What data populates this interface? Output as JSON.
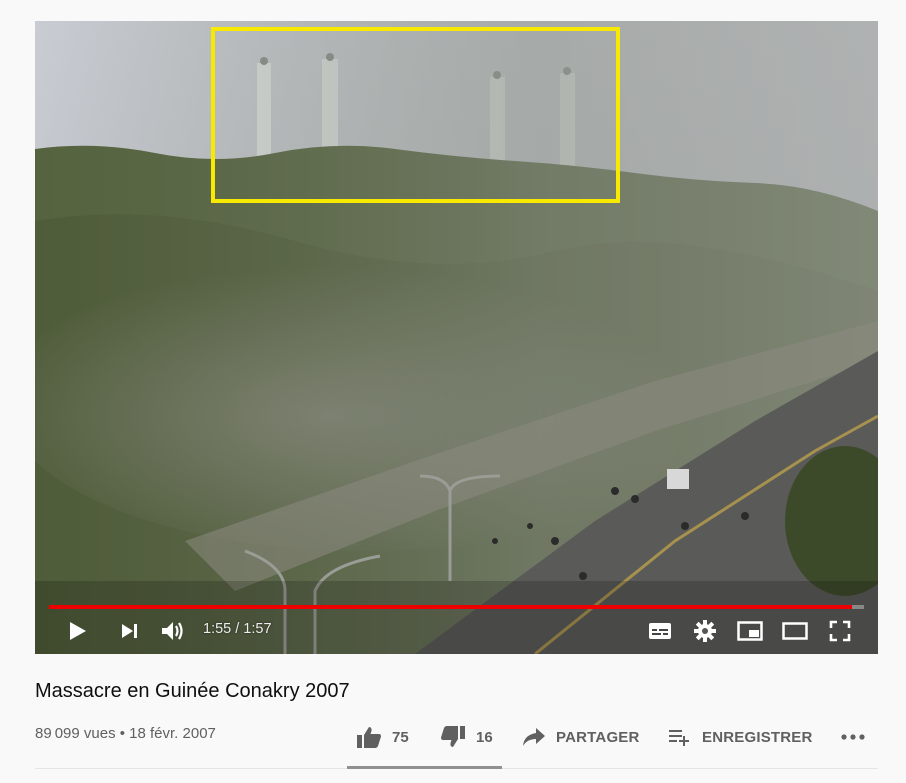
{
  "video": {
    "time_display": "1:55 / 1:57",
    "progress_fraction": 0.985
  },
  "controls": {
    "play_icon": "play-icon",
    "next_icon": "next-icon",
    "volume_icon": "volume-icon",
    "subtitles_icon": "subtitles-icon",
    "settings_icon": "gear-icon",
    "miniplayer_icon": "miniplayer-icon",
    "theater_icon": "theater-icon",
    "fullscreen_icon": "fullscreen-icon"
  },
  "info": {
    "title": "Massacre en Guinée Conakry 2007",
    "meta": "89 099 vues • 18 févr. 2007"
  },
  "actions": {
    "like_count": "75",
    "dislike_count": "16",
    "share_label": "PARTAGER",
    "save_label": "ENREGISTRER",
    "more_icon": "more-icon"
  },
  "colors": {
    "progress": "#ee0000",
    "highlight_box": "#f7ea00",
    "text_secondary": "#606060"
  }
}
